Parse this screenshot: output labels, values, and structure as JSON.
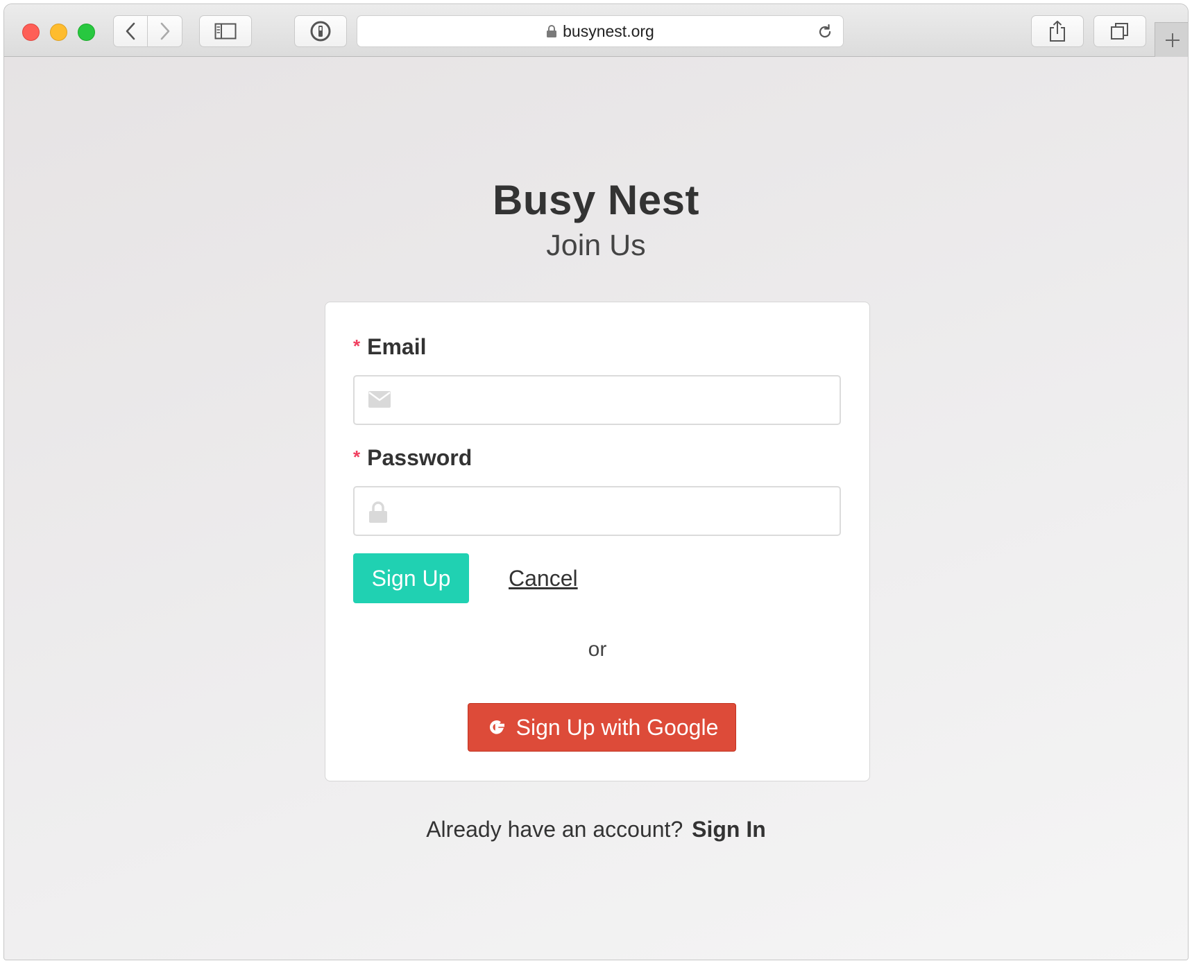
{
  "browser": {
    "address_url": "busynest.org"
  },
  "page": {
    "brand": "Busy Nest",
    "subtitle": "Join Us",
    "form": {
      "required_marker": "*",
      "email_label": "Email",
      "email_value": "",
      "password_label": "Password",
      "password_value": "",
      "signup_label": "Sign Up",
      "cancel_label": "Cancel",
      "or_text": "or",
      "google_label": "Sign Up with Google"
    },
    "footer": {
      "prompt": "Already have an account?",
      "signin_label": "Sign In"
    }
  },
  "colors": {
    "signup_button": "#20d1b2",
    "google_button": "#dd4b39",
    "required_marker": "#f04060",
    "traffic_close": "#fe5f57",
    "traffic_minimize": "#febc2e",
    "traffic_zoom": "#28c840"
  },
  "icons": {
    "back": "chevron-left-icon",
    "forward": "chevron-right-icon",
    "sidebar": "sidebar-icon",
    "password_manager": "password-manager-icon",
    "lock": "lock-icon",
    "reload": "reload-icon",
    "share": "share-icon",
    "tabs": "tabs-overview-icon",
    "new_tab": "plus-icon",
    "email_field": "envelope-icon",
    "password_field": "lock-icon",
    "google": "google-g-icon"
  }
}
